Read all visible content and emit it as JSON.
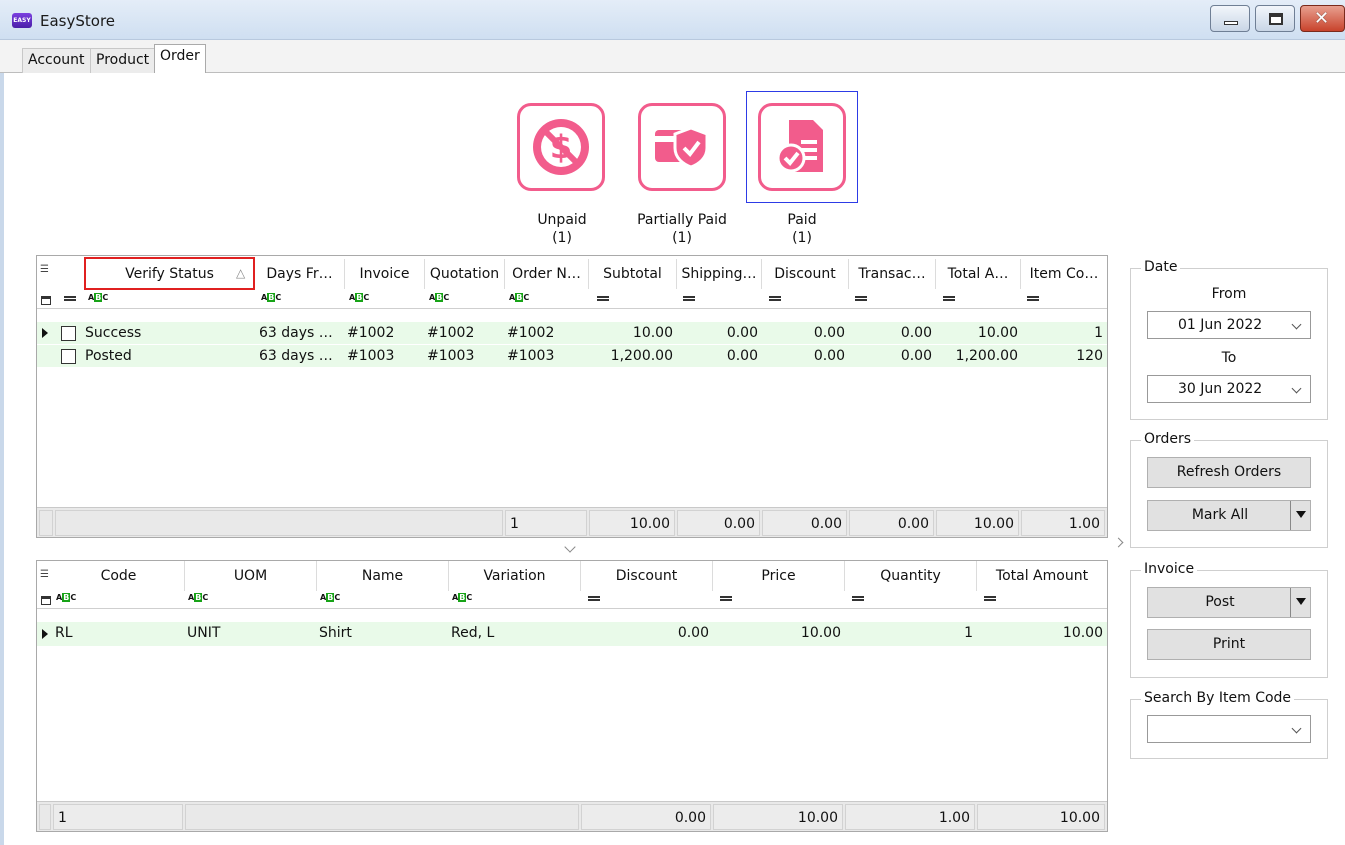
{
  "window": {
    "title": "EasyStore",
    "logo_text": "EASY"
  },
  "tabs": [
    {
      "label": "Account"
    },
    {
      "label": "Product"
    },
    {
      "label": "Order"
    }
  ],
  "payment_status": [
    {
      "label": "Unpaid",
      "count": "(1)",
      "icon": "no-dollar-icon"
    },
    {
      "label": "Partially Paid",
      "count": "(1)",
      "icon": "card-shield-icon"
    },
    {
      "label": "Paid",
      "count": "(1)",
      "icon": "invoice-check-icon",
      "selected": true
    }
  ],
  "accent_color": "#f25c8c",
  "orders_grid": {
    "columns": [
      "Verify Status",
      "Days Fr…",
      "Invoice",
      "Quotation",
      "Order N…",
      "Subtotal",
      "Shipping…",
      "Discount",
      "Transac…",
      "Total A…",
      "Item Co…"
    ],
    "sort_indicator": "△",
    "rows": [
      {
        "status": "Success",
        "days": "63 days …",
        "invoice": "#1002",
        "quotation": "#1002",
        "order": "#1002",
        "subtotal": "10.00",
        "shipping": "0.00",
        "discount": "0.00",
        "transaction": "0.00",
        "total": "10.00",
        "items": "1"
      },
      {
        "status": "Posted",
        "days": "63 days …",
        "invoice": "#1003",
        "quotation": "#1003",
        "order": "#1003",
        "subtotal": "1,200.00",
        "shipping": "0.00",
        "discount": "0.00",
        "transaction": "0.00",
        "total": "1,200.00",
        "items": "120"
      }
    ],
    "footer": {
      "order_count": "1",
      "subtotal": "10.00",
      "shipping": "0.00",
      "discount": "0.00",
      "transaction": "0.00",
      "total": "10.00",
      "items": "1.00"
    }
  },
  "items_grid": {
    "columns": [
      "Code",
      "UOM",
      "Name",
      "Variation",
      "Discount",
      "Price",
      "Quantity",
      "Total Amount"
    ],
    "rows": [
      {
        "code": "RL",
        "uom": "UNIT",
        "name": "Shirt",
        "variation": "Red, L",
        "discount": "0.00",
        "price": "10.00",
        "quantity": "1",
        "total": "10.00"
      }
    ],
    "footer": {
      "count": "1",
      "discount": "0.00",
      "price": "10.00",
      "quantity": "1.00",
      "total": "10.00"
    }
  },
  "date_group": {
    "title": "Date",
    "from_label": "From",
    "from_value": "01 Jun 2022",
    "to_label": "To",
    "to_value": "30 Jun 2022"
  },
  "orders_group": {
    "title": "Orders",
    "refresh_label": "Refresh Orders",
    "mark_all_label": "Mark All"
  },
  "invoice_group": {
    "title": "Invoice",
    "post_label": "Post",
    "print_label": "Print"
  },
  "search_group": {
    "title": "Search By Item Code",
    "value": ""
  }
}
